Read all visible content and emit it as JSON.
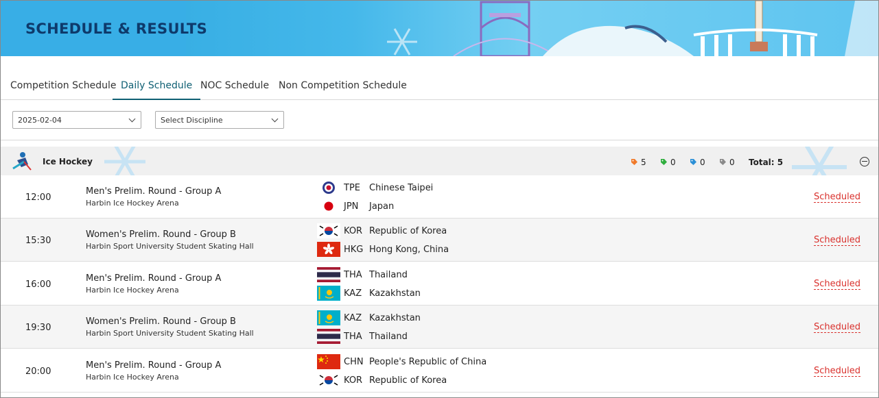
{
  "banner": {
    "title": "SCHEDULE & RESULTS"
  },
  "tabs": [
    {
      "label": "Competition Schedule"
    },
    {
      "label": "Daily Schedule"
    },
    {
      "label": "NOC Schedule"
    },
    {
      "label": "Non Competition Schedule"
    }
  ],
  "active_tab": "Daily Schedule",
  "filters": {
    "date": {
      "value": "2025-02-04",
      "icon": "chevron-down-icon"
    },
    "discipline": {
      "value": "Select Discipline",
      "icon": "chevron-down-icon"
    }
  },
  "discipline": {
    "name": "Ice Hockey",
    "icon": "ice-hockey-pictogram-icon",
    "counts": [
      {
        "color": "#f07a2a",
        "value": "5"
      },
      {
        "color": "#2fae3e",
        "value": "0"
      },
      {
        "color": "#2b8fd6",
        "value": "0"
      },
      {
        "color": "#8a8a8a",
        "value": "0"
      }
    ],
    "total": "Total: 5"
  },
  "matches": [
    {
      "time": "12:00",
      "event": "Men's Prelim. Round - Group A",
      "venue": "Harbin Ice Hockey Arena",
      "teams": [
        {
          "code": "TPE",
          "name": "Chinese Taipei",
          "flag": "tpe"
        },
        {
          "code": "JPN",
          "name": "Japan",
          "flag": "jpn"
        }
      ],
      "status": "Scheduled"
    },
    {
      "time": "15:30",
      "event": "Women's Prelim. Round - Group B",
      "venue": "Harbin Sport University Student Skating Hall",
      "teams": [
        {
          "code": "KOR",
          "name": "Republic of Korea",
          "flag": "kor"
        },
        {
          "code": "HKG",
          "name": "Hong Kong, China",
          "flag": "hkg"
        }
      ],
      "status": "Scheduled"
    },
    {
      "time": "16:00",
      "event": "Men's Prelim. Round - Group A",
      "venue": "Harbin Ice Hockey Arena",
      "teams": [
        {
          "code": "THA",
          "name": "Thailand",
          "flag": "tha"
        },
        {
          "code": "KAZ",
          "name": "Kazakhstan",
          "flag": "kaz"
        }
      ],
      "status": "Scheduled"
    },
    {
      "time": "19:30",
      "event": "Women's Prelim. Round - Group B",
      "venue": "Harbin Sport University Student Skating Hall",
      "teams": [
        {
          "code": "KAZ",
          "name": "Kazakhstan",
          "flag": "kaz"
        },
        {
          "code": "THA",
          "name": "Thailand",
          "flag": "tha"
        }
      ],
      "status": "Scheduled"
    },
    {
      "time": "20:00",
      "event": "Men's Prelim. Round - Group A",
      "venue": "Harbin Ice Hockey Arena",
      "teams": [
        {
          "code": "CHN",
          "name": "People's Republic of China",
          "flag": "chn"
        },
        {
          "code": "KOR",
          "name": "Republic of Korea",
          "flag": "kor"
        }
      ],
      "status": "Scheduled"
    }
  ]
}
